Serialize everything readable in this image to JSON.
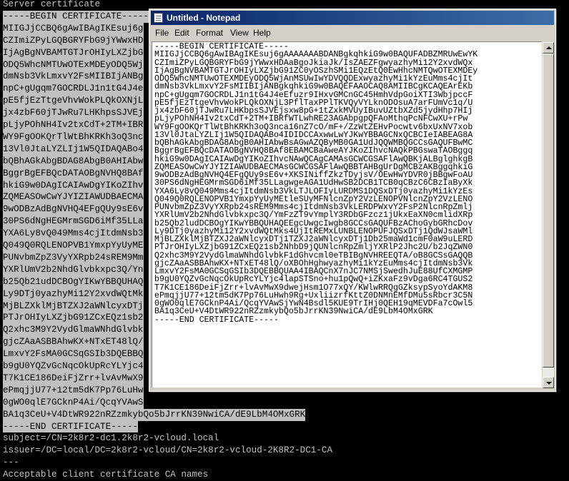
{
  "console": {
    "lines": [
      {
        "text": "Server certificate",
        "selected": false
      },
      {
        "text": "-----BEGIN CERTIFICATE-----",
        "selected": true
      },
      {
        "text": "MIIGJjCCBQ6gAwIBAgIKEsuj6g",
        "selected": true
      },
      {
        "text": "CZImiZPyLGQBGRYFbG9jYWwxHD",
        "selected": true
      },
      {
        "text": "IjAgBgNVBAMTGTJrOHIyLXZjbG",
        "selected": true
      },
      {
        "text": "ODQ5WhcNMTUwOTExMDEyODQ5Wj",
        "selected": true
      },
      {
        "text": "dmNsb3VkLmxvY2FsMIIBIjANBg",
        "selected": true
      },
      {
        "text": "npC+gUgqm7GOCRDLJ1n1tG4J4e",
        "selected": true
      },
      {
        "text": "pE5fjEzTtgeVhvWokPLQkOXNjL",
        "selected": true
      },
      {
        "text": "jx4zbF60jTJwRu7LHKhpsSJVEj",
        "selected": true
      },
      {
        "text": "pLjyPOhNH4Iv2txCdT+2TM+IBR",
        "selected": true
      },
      {
        "text": "WY9FgOOKQrTlWtBhKRKh3oQ3nc",
        "selected": true
      },
      {
        "text": "13Vl0JtaLYZLIj1W5QIDAQABo4",
        "selected": true
      },
      {
        "text": "bQBhAGkAbgBDAG8AbgB0AHIAbw",
        "selected": true
      },
      {
        "text": "BggrBgEFBQcDATAOBgNVHQ8BAf",
        "selected": true
      },
      {
        "text": "hkiG9w0DAgICAIAwDgYIKoZIhv",
        "selected": true
      },
      {
        "text": "ZQMEASOwCwYJYIZIAWUDBAECMA",
        "selected": true
      },
      {
        "text": "9wODBzAdBgNVHQ4EFgQUy9sE6v",
        "selected": true
      },
      {
        "text": "30PS6dNgHEGMrmSGD6iMf35LLa",
        "selected": true
      },
      {
        "text": "YXA6Ly8vQ049Mms4cjItdmNsb3",
        "selected": true
      },
      {
        "text": "Q049Q0RQLENOPVB1YmxpYyUyME",
        "selected": true
      },
      {
        "text": "PUNvbmZpZ3VyYXRpb24sREM9Mm",
        "selected": true
      },
      {
        "text": "YXRlUmV2b2NhdGlvbkxpc3Q/Yn",
        "selected": true
      },
      {
        "text": "b25Qb21udDCBOgYIKwYBBQUHAQ",
        "selected": true
      },
      {
        "text": "Ly9DTj0yazhyMi12Y2xvdWQtMk",
        "selected": true
      },
      {
        "text": "MjBLZXklMjBTZXJ2aWNlcyxDTj",
        "selected": true
      },
      {
        "text": "PTJrOHIyLXZjbG91ZCxEQz1sb2",
        "selected": true
      },
      {
        "text": "Q2xhc3M9Y2VydGlmaWNhdGlvbk",
        "selected": true
      },
      {
        "text": "gjcZAaASBBAhwKX+NTxET48lQ/",
        "selected": true
      },
      {
        "text": "LmxvY2FsMA0GCSqGSIb3DQEBBQ",
        "selected": true
      },
      {
        "text": "b9gU0YQZvGcNqcOkUpRcYLYjc4",
        "selected": true
      },
      {
        "text": "T7K1CE186DeiFjZrr+lvAvMwX9",
        "selected": true
      },
      {
        "text": "ePmqjjU77+12tm5dK7Pp76LuHw",
        "selected": true
      },
      {
        "text": "0gWO0qlE7GCknP4Ai/QcqYVAwS",
        "selected": true
      },
      {
        "text": "BA1q3CeU+V4DtWR922nRZzmkybQo5bJrrKN39NwiCA/dE9LbM4OMxGRK",
        "selected": true
      },
      {
        "text": "-----END CERTIFICATE-----",
        "selected": true
      },
      {
        "text": "subject=/CN=2k8r2-dc1.2k8r2-vcloud.local",
        "selected": false
      },
      {
        "text": "issuer=/DC=local/DC=2k8r2-vcloud/CN=2k8r2-vcloud-2K8R2-DC1-CA",
        "selected": false
      },
      {
        "text": "---",
        "selected": false
      },
      {
        "text": "Acceptable client certificate CA names",
        "selected": false
      }
    ]
  },
  "notepad": {
    "title": "Untitled - Notepad",
    "menu": [
      "File",
      "Edit",
      "Format",
      "View",
      "Help"
    ],
    "content": "-----BEGIN CERTIFICATE-----\nMIIGJjCCBQ6gAwIBAgIKEsuj6gAAAAAAABDANBgkqhkiG9w0BAQUFADBZMRUwEwYK\nCZImiZPyLGQBGRYFbG9jYWwxHDAaBgoJkiaJk/IsZAEZFgwyazhyMi12Y2xvdWQx\nIjAgBgNVBAMTGTJrOHIyLXZjbG91ZC0yOSzhSMi1EQzEtQ0EwHhcNMTQwOTEXMDEy\nODQ5WhcNMTUwOTEXMDEyODQ5WjAnMSUwIwYDVQQDExwyazhyMi1kYzEuMms4cjIt\ndmNsb3VkLmxvY2FsMIIBIjANBgkqhkiG9w0BAQEFAAOCAQ8AMIIBCgKCAQEArEKb\nnpC+gUgqm7GOCRDLJ1n1tG4J4eEfuzr9IHxvGMCnGC45HmhVdpGoiXTI3WbjpccF\npE5fjEzTtgeVhvWokPLQkOXNjL3PflTaxPPlTKVQyVYLknODOsuA7arFUmVc1q/U\njx4zbF60jTJwRu7LHKbpsSJVEjsxw8pG+1tZxkMVUyIBuvUZtbXZd5jydHhp7HIj\npLjyPOhNH4Iv2txCdT+2TM+IBRfWTLwhRE23AGAbpgpQFAoMthqPcNFCwXU+rPw\nWY9FgOOKQrTlWtBhKRKh3oQ3nca16nZ7cO/mF+/ZzWtZEHvPocwtv6bxUxNV7xob\n13Vl0JtaLYZLIj1W5QIDAQABo4IDIDCCAxwwLwYJKwYBBAGCNxQCBCIeIABEAG8A\nbQBhAGkAbgBDAG8AbgB0AHIAbwBsAGwAZQByMB0GA1UdJQQWMBQGCCsGAQUFBwMC\nBggrBgEFBQcDATAOBgNVHQ8BAf8EBAMCBaAweAYJKoZIhvcNAQkPBGswaTAOBggq\nhkiG9w0DAgICAIAwDgYIKoZIhvcNAwQCAgCAMAsGCWCGSAFlAwQBKjALBglghkgB\nZQMEASOwCwYJYIZIAWUDBAECMAsGCWCGSAFlAwQBBTAHBgUrDgMCBzAKBggqhkiG\n9wODBzAdBgNVHQ4EFgQUy9sE6v+XKSINiffZkzTDyjsV/OEwHwYDVR0jBBgwFoAU\n30PS6dNgHEGMrmSGD6iMf35LLagwgeAGA1UdHwSB2DCB1TCB0qCBzC6CBzIaByXk\nYXA6Ly8vQ049Mms4cjItdmNsb3VkLTJLOFIyLURDMS1DQSxDTj0yazhyMi1kYzEs\nQ049Q0RQLENOPVB1YmxpYyUyMEtleSUyMFNlcnZpY2VzLENOPVNlcnZpY2VzLENO\nPUNvbmZpZ3VyYXRpb24sREM9Mms4cjItdmNsb3VkLERDPWxvY2FsP2NlcnRpZmlj\nYXRlUmV2b2NhdGlvbkxpc3Q/YmFzZT9vYmplY3RDbGFzcz1jUkxEaXN0cmlidXRp\nb25Qb2ludDCBOgYIKwYBBQUHAQEEgcUwgcIwgb8GCCsGAQUFBzAChoGybGRhcDov\nLy9DTj0yazhyMi12Y2xvdWQtMks4UjItREMxLUNBLENOPUFJQSxDTj1QdWJsaWMl\nMjBLZXklMjBTZXJ2aWNlcyxDTj1TZXJ2aWNlcyxDTj1Db25maWd1cmF0aW9uLERD\nPTJrOHIyLXZjbG91ZCxEQz1sb2NhbD9jQUNlcnRpZmljYXRlP2Jhc2U/b2JqZWN0\nQ2xhc3M9Y2VydGlmaWNhdGlvbkF1dGhvcml0eTBIBgNVHREEQTA/oB8GCSsGAQQB\ngjcZAaASBBAhwKX+NTxET48lQ/oXBOhHghwyazhyMi1kYzEuMms4cjItdmNsb3Vk\nLmxvY2FsMA0GCSqGSIb3DQEBBQUAA4IBAQCnX7nJC7NMSjSwedhJuE88UfCXMGMP\nb9gU0YQZvGcNqcOkUpRcYLYjc4lapSTSno+hu1pQwQ+iZKxaFz9vDga6RC4TGUS2\nT7K1CE186DeiFjZrr+lvAvMwX9dwejHsm1O77xQY/KWlwRRQgGZksypSyoYdAKM8\nePmqjjU77+12tm5dK7Pp76LuHwh9Rg+UxliizrfKttZ0DNMnEMfDMu5sRbcr3C5N\n0gWO0qlE7GCknP4Ai/QcqYVAwSjYwN4Bsdl5KUE9TrIHj0QEH19qMEVDFa7cOwl5\nBA1q3CeU+V4DtWR922nRZzmkybQo5bJrrKN39NwiCA/dE9LbM4OMxGRK\n-----END CERTIFICATE-----"
  },
  "icons": {
    "app": "notepad-icon",
    "scroll_up": "scroll-up-arrow-icon",
    "scroll_down": "scroll-down-arrow-icon"
  },
  "colors": {
    "console_bg": "#000000",
    "console_text": "#c0c0c0",
    "selection_bg": "#c0c0c0",
    "titlebar": "#0a246a"
  }
}
